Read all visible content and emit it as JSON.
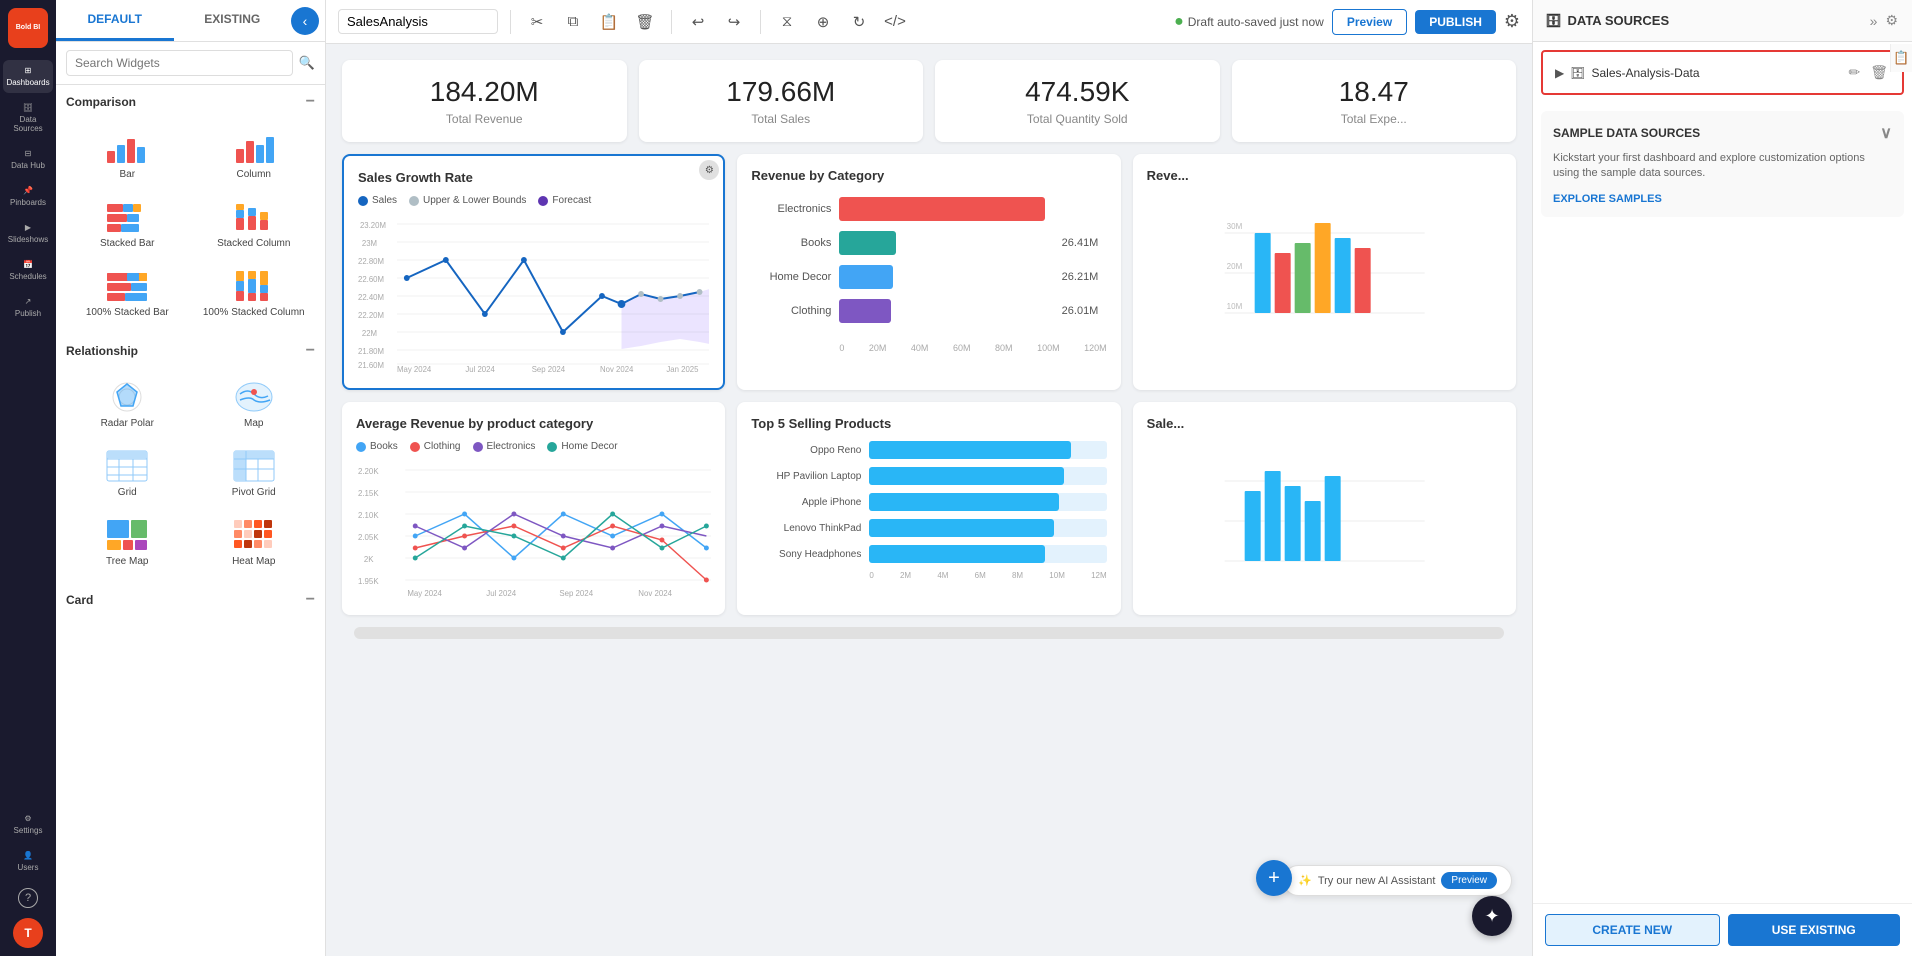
{
  "app": {
    "name": "Bold BI",
    "dashboard_title": "SalesAnalysis"
  },
  "toolbar": {
    "title": "SalesAnalysis",
    "auto_saved": "Draft auto-saved just now",
    "preview_label": "Preview",
    "publish_label": "PUBLISH",
    "buttons": [
      "cut",
      "copy",
      "paste",
      "delete",
      "undo",
      "redo",
      "filter",
      "embed",
      "refresh",
      "code"
    ]
  },
  "tabs": {
    "default_label": "DEFAULT",
    "existing_label": "EXISTING"
  },
  "search": {
    "placeholder": "Search Widgets"
  },
  "comparison_section": {
    "title": "Comparison"
  },
  "widgets": {
    "comparison": [
      {
        "id": "bar",
        "label": "Bar"
      },
      {
        "id": "column",
        "label": "Column"
      },
      {
        "id": "stacked-bar",
        "label": "Stacked Bar"
      },
      {
        "id": "stacked-column",
        "label": "Stacked Column"
      },
      {
        "id": "100-stacked-bar",
        "label": "100% Stacked Bar"
      },
      {
        "id": "100-stacked-column",
        "label": "100% Stacked Column"
      }
    ],
    "relationship": [
      {
        "id": "radar-polar",
        "label": "Radar Polar"
      },
      {
        "id": "map",
        "label": "Map"
      },
      {
        "id": "grid",
        "label": "Grid"
      },
      {
        "id": "pivot-grid",
        "label": "Pivot Grid"
      },
      {
        "id": "tree-map",
        "label": "Tree Map"
      }
    ],
    "card": {
      "title": "Card"
    }
  },
  "kpis": [
    {
      "value": "184.20M",
      "label": "Total Revenue"
    },
    {
      "value": "179.66M",
      "label": "Total Sales"
    },
    {
      "value": "474.59K",
      "label": "Total Quantity Sold"
    },
    {
      "value": "18.47",
      "label": "Total Expe..."
    }
  ],
  "sales_growth": {
    "title": "Sales Growth Rate",
    "legend": [
      {
        "key": "sales",
        "label": "Sales",
        "color": "#1565c0"
      },
      {
        "key": "bounds",
        "label": "Upper & Lower Bounds",
        "color": "#b0bec5"
      },
      {
        "key": "forecast",
        "label": "Forecast",
        "color": "#5e35b1"
      }
    ],
    "y_labels": [
      "23.20M",
      "23M",
      "22.80M",
      "22.60M",
      "22.40M",
      "22.20M",
      "22M",
      "21.80M",
      "21.60M"
    ],
    "x_labels": [
      "May 2024",
      "Jul 2024",
      "Sep 2024",
      "Nov 2024",
      "Jan 2025"
    ]
  },
  "revenue_by_category": {
    "title": "Revenue by Category",
    "bars": [
      {
        "label": "Electronics",
        "color": "#ef5350",
        "value": "",
        "width_pct": 95
      },
      {
        "label": "Books",
        "color": "#26a69a",
        "value": "26.41M",
        "width_pct": 25
      },
      {
        "label": "Home Decor",
        "color": "#42a5f5",
        "value": "26.21M",
        "width_pct": 24
      },
      {
        "label": "Clothing",
        "color": "#7e57c2",
        "value": "26.01M",
        "width_pct": 23
      }
    ],
    "x_axis": [
      "0",
      "20M",
      "40M",
      "60M",
      "80M",
      "100M",
      "120M"
    ]
  },
  "avg_revenue": {
    "title": "Average Revenue by product category",
    "legend": [
      {
        "label": "Books",
        "color": "#42a5f5"
      },
      {
        "label": "Clothing",
        "color": "#ef5350"
      },
      {
        "label": "Electronics",
        "color": "#7e57c2"
      },
      {
        "label": "Home Decor",
        "color": "#26a69a"
      }
    ],
    "y_labels": [
      "2.20K",
      "2.15K",
      "2.10K",
      "2.05K",
      "2K",
      "1.95K"
    ],
    "x_labels": [
      "May 2024",
      "Jul 2024",
      "Sep 2024",
      "Nov 2024"
    ]
  },
  "top5_products": {
    "title": "Top 5 Selling Products",
    "products": [
      {
        "name": "Oppo Reno",
        "width_pct": 85
      },
      {
        "name": "HP Pavilion Laptop",
        "width_pct": 82
      },
      {
        "name": "Apple iPhone",
        "width_pct": 80
      },
      {
        "name": "Lenovo ThinkPad",
        "width_pct": 78
      },
      {
        "name": "Sony Headphones",
        "width_pct": 74
      }
    ],
    "x_axis": [
      "0",
      "2M",
      "4M",
      "6M",
      "8M",
      "10M",
      "12M"
    ]
  },
  "data_sources": {
    "title": "DATA SOURCES",
    "item": "Sales-Analysis-Data",
    "expand_icon": "▶",
    "db_icon": "🗄"
  },
  "sample_ds": {
    "title": "SAMPLE DATA SOURCES",
    "description": "Kickstart your first dashboard and explore customization options using the sample data sources.",
    "explore_label": "EXPLORE SAMPLES",
    "create_label": "CREATE NEW",
    "use_existing_label": "USE EXISTING"
  },
  "nav": {
    "items": [
      {
        "id": "dashboards",
        "icon": "⊞",
        "label": "Dashboards"
      },
      {
        "id": "data-sources",
        "icon": "🗄",
        "label": "Data Sources"
      },
      {
        "id": "data-hub",
        "icon": "⊟",
        "label": "Data Hub"
      },
      {
        "id": "pinboards",
        "icon": "📌",
        "label": "Pinboards"
      },
      {
        "id": "slideshows",
        "icon": "▶",
        "label": "Slideshows"
      },
      {
        "id": "schedules",
        "icon": "📅",
        "label": "Schedules"
      },
      {
        "id": "publish",
        "icon": "↗",
        "label": "Publish"
      },
      {
        "id": "settings",
        "icon": "⚙",
        "label": "Settings"
      },
      {
        "id": "users",
        "icon": "👤",
        "label": "Users"
      }
    ],
    "help_icon": "?",
    "avatar_label": "T"
  },
  "ai_banner": {
    "text": "Try our new AI Assistant",
    "preview_label": "Preview"
  }
}
